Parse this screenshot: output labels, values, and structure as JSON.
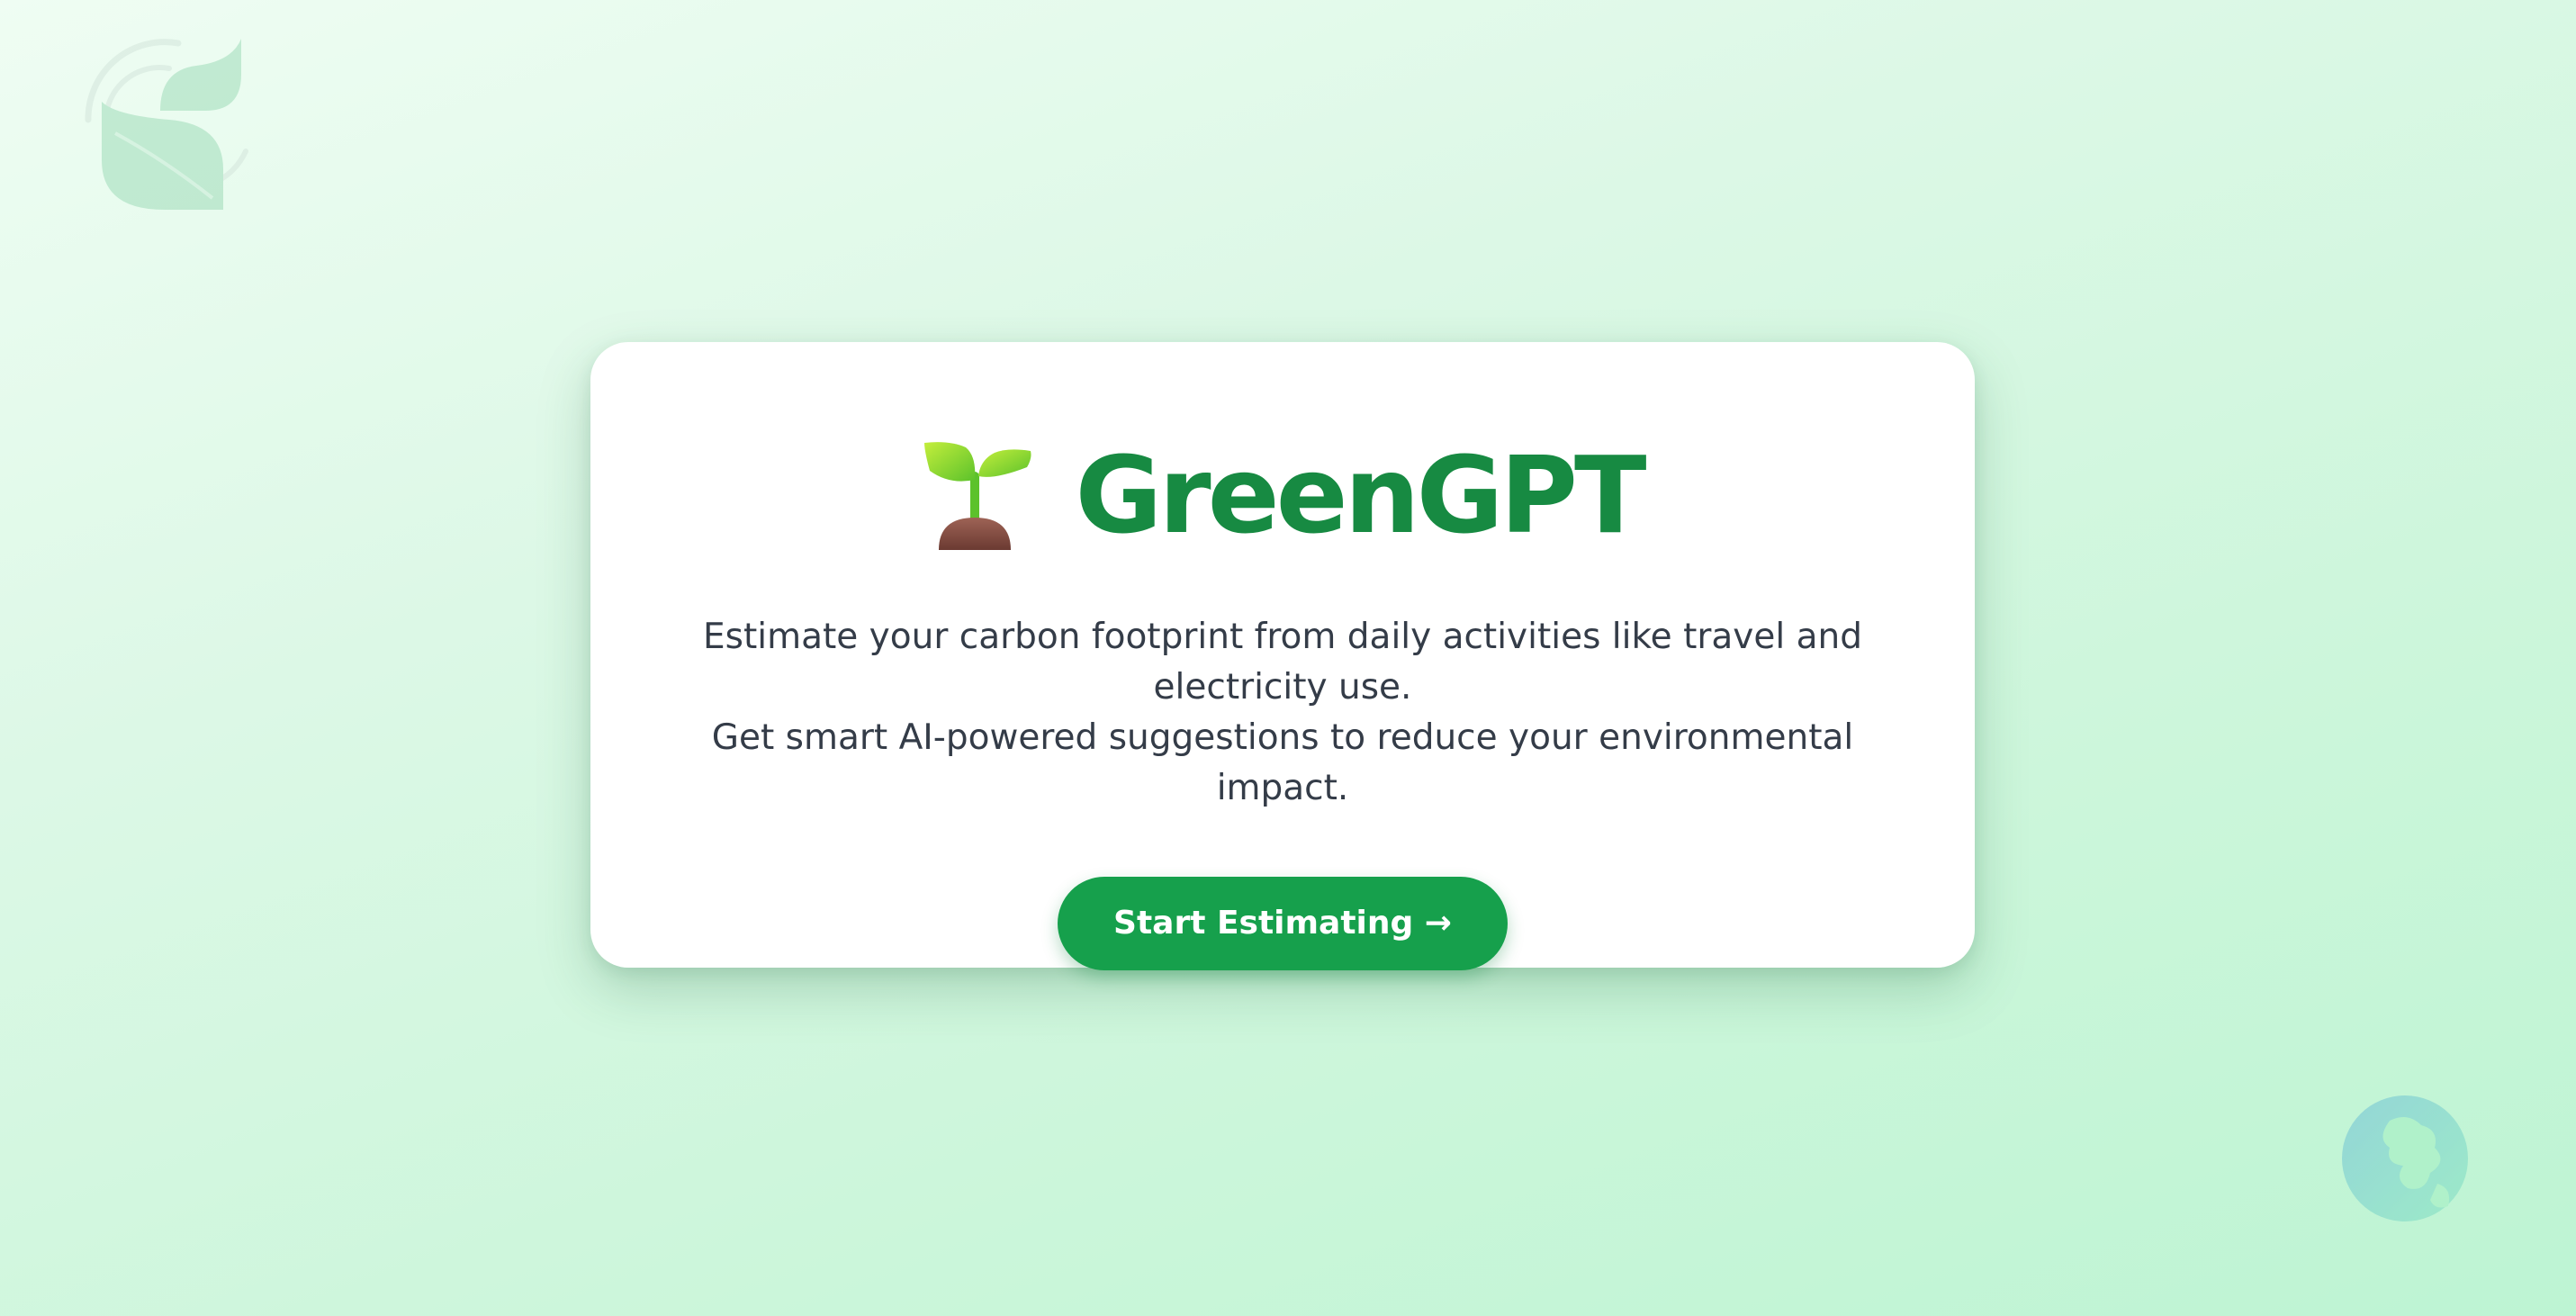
{
  "hero": {
    "title": "GreenGPT",
    "description_line1": "Estimate your carbon footprint from daily activities like travel and electricity use.",
    "description_line2": "Get smart AI-powered suggestions to reduce your environmental impact.",
    "cta_label": "Start Estimating →"
  },
  "icons": {
    "brand": "seedling-icon",
    "decor_top_left": "leaves-icon",
    "decor_bottom_right": "globe-icon"
  },
  "colors": {
    "brand_green": "#178a42",
    "button_green": "#16a04c",
    "text": "#343c48",
    "background_start": "#effdf3",
    "background_end": "#bdf4d3"
  }
}
